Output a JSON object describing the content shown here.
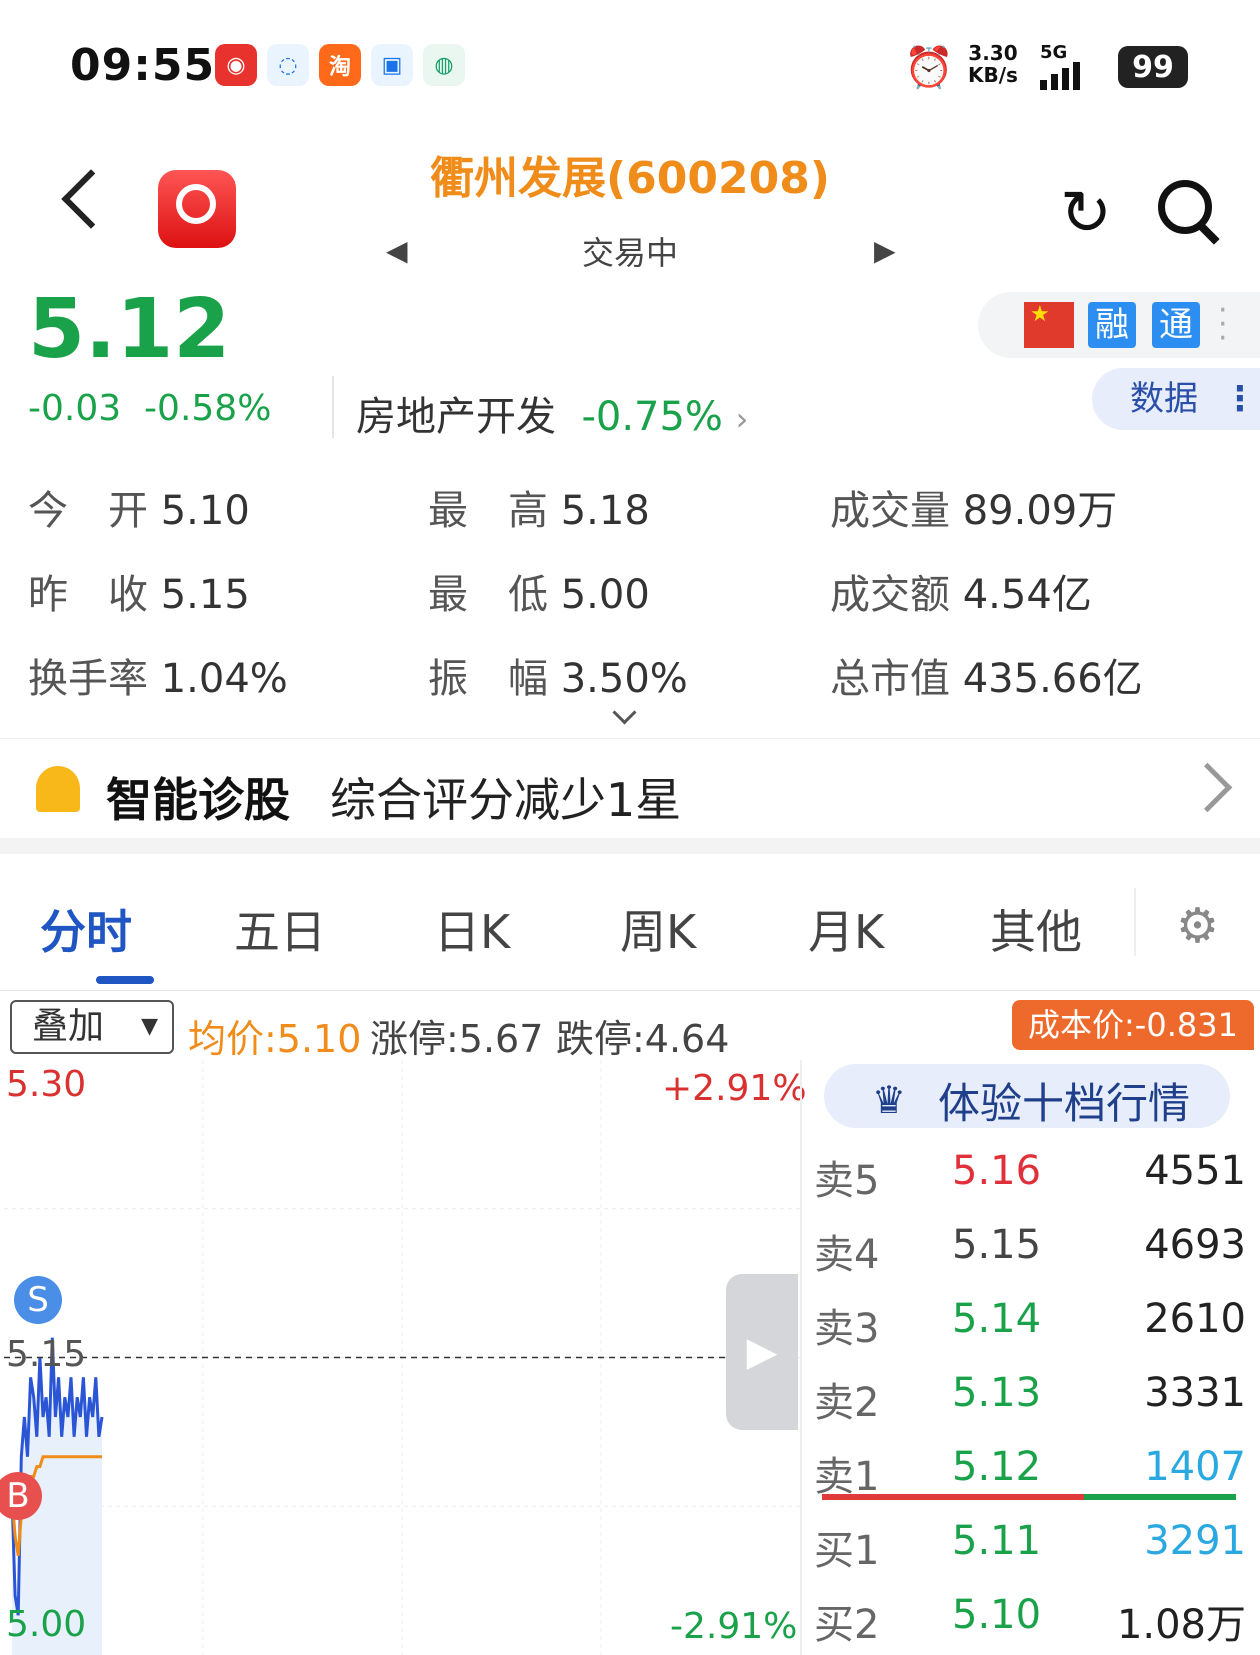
{
  "status_bar": {
    "time": "09:55",
    "net_speed_value": "3.30",
    "net_speed_unit": "KB/s",
    "network": "5G",
    "battery": "99"
  },
  "header": {
    "title": "衢州发展(600208)",
    "subtitle": "交易中"
  },
  "quote": {
    "price": "5.12",
    "change": "-0.03",
    "change_pct": "-0.58%",
    "sector": "房地产开发",
    "sector_pct": "-0.75%",
    "badges": [
      "融",
      "通"
    ],
    "data_button": "数据"
  },
  "stats": [
    {
      "label": "今　开",
      "value": "5.10"
    },
    {
      "label": "最　高",
      "value": "5.18"
    },
    {
      "label": "成交量",
      "value": "89.09万"
    },
    {
      "label": "昨　收",
      "value": "5.15"
    },
    {
      "label": "最　低",
      "value": "5.00"
    },
    {
      "label": "成交额",
      "value": "4.54亿"
    },
    {
      "label": "换手率",
      "value": "1.04%"
    },
    {
      "label": "振　幅",
      "value": "3.50%"
    },
    {
      "label": "总市值",
      "value": "435.66亿"
    }
  ],
  "diagnosis": {
    "title": "智能诊股",
    "text": "综合评分减少1星"
  },
  "tabs": [
    "分时",
    "五日",
    "日K",
    "周K",
    "月K",
    "其他"
  ],
  "chart_header": {
    "overlay": "叠加",
    "avg": "均价:5.10",
    "limit_up": "涨停:5.67",
    "limit_down": "跌停:4.64",
    "cost": "成本价:-0.831"
  },
  "chart_labels": {
    "top_price": "5.30",
    "top_pct": "+2.91%",
    "mid_price": "5.15",
    "bottom_price": "5.00",
    "bottom_pct": "-2.91%",
    "sell_marker": "S",
    "buy_marker": "B"
  },
  "chart_data": {
    "type": "line",
    "ylim": [
      5.0,
      5.3
    ],
    "reference_price": 5.15,
    "series": [
      {
        "values": [
          5.08,
          5.03,
          5.02,
          5.1,
          5.12,
          5.1,
          5.14,
          5.13,
          5.11,
          5.15,
          5.12,
          5.13,
          5.11,
          5.16,
          5.12,
          5.14,
          5.11,
          5.13,
          5.12,
          5.14,
          5.11,
          5.13,
          5.12,
          5.14,
          5.11,
          5.13,
          5.12,
          5.14,
          5.11,
          5.12
        ]
      },
      {
        "values": [
          5.08,
          5.06,
          5.05,
          5.07,
          5.08,
          5.085,
          5.09,
          5.09,
          5.095,
          5.095,
          5.1,
          5.1,
          5.1,
          5.1,
          5.1,
          5.1,
          5.1,
          5.1,
          5.1,
          5.1,
          5.1,
          5.1,
          5.1,
          5.1,
          5.1,
          5.1,
          5.1,
          5.1,
          5.1,
          5.1
        ]
      }
    ]
  },
  "order_book": {
    "vip_label": "体验十档行情",
    "rows": [
      {
        "label": "卖5",
        "price": "5.16",
        "volume": "4551",
        "price_color": "#e0303a",
        "vol_color": "#222"
      },
      {
        "label": "卖4",
        "price": "5.15",
        "volume": "4693",
        "price_color": "#444",
        "vol_color": "#222"
      },
      {
        "label": "卖3",
        "price": "5.14",
        "volume": "2610",
        "price_color": "#1aa24a",
        "vol_color": "#222"
      },
      {
        "label": "卖2",
        "price": "5.13",
        "volume": "3331",
        "price_color": "#1aa24a",
        "vol_color": "#222"
      },
      {
        "label": "卖1",
        "price": "5.12",
        "volume": "1407",
        "price_color": "#1aa24a",
        "vol_color": "#2aa9e0"
      },
      {
        "label": "买1",
        "price": "5.11",
        "volume": "3291",
        "price_color": "#1aa24a",
        "vol_color": "#2aa9e0"
      },
      {
        "label": "买2",
        "price": "5.10",
        "volume": "1.08万",
        "price_color": "#1aa24a",
        "vol_color": "#222"
      }
    ]
  }
}
